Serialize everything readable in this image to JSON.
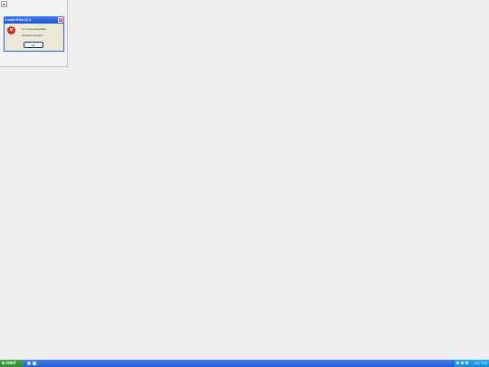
{
  "dialog": {
    "title": "Local Disk (C:)",
    "message_line1": "C:\\ is not accessible.",
    "message_line2": "Access is denied.",
    "ok_label": "OK",
    "close_glyph": "×",
    "icon": "error-icon"
  },
  "taskbar": {
    "start_label": "start",
    "start_icon": "windows-flag-icon",
    "quick_launch": [
      "ie-icon",
      "desktop-icon"
    ],
    "tray_icons": [
      "network-icon",
      "volume-icon",
      "shield-icon"
    ],
    "clock": "1:17 PM"
  },
  "colors": {
    "taskbar": "#245edb",
    "start_button": "#2e8b2e",
    "title_bar": "#1f55d6",
    "error_red": "#cc2a1e",
    "desktop": "#efefef"
  }
}
